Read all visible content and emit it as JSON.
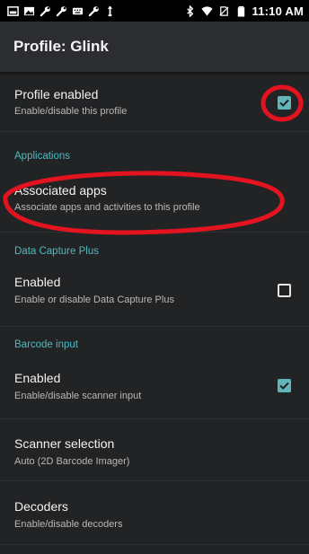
{
  "status_bar": {
    "time": "11:10 AM",
    "notification_icons": [
      "image-icon",
      "photo-icon",
      "wrench-icon",
      "wrench-icon",
      "keyboard-icon",
      "wrench-icon",
      "usb-icon"
    ],
    "system_icons": [
      "bluetooth-icon",
      "wifi-icon",
      "no-sim-icon",
      "battery-icon"
    ]
  },
  "app_bar": {
    "title": "Profile: Glink"
  },
  "preferences": {
    "profile_enabled": {
      "title": "Profile enabled",
      "summary": "Enable/disable this profile",
      "checked": true
    },
    "applications_header": "Applications",
    "associated_apps": {
      "title": "Associated apps",
      "summary": "Associate apps and activities to this profile"
    },
    "data_capture_header": "Data Capture Plus",
    "dcp_enabled": {
      "title": "Enabled",
      "summary": "Enable or disable Data Capture Plus",
      "checked": false
    },
    "barcode_header": "Barcode input",
    "barcode_enabled": {
      "title": "Enabled",
      "summary": "Enable/disable scanner input",
      "checked": true
    },
    "scanner_selection": {
      "title": "Scanner selection",
      "summary": "Auto (2D Barcode Imager)"
    },
    "decoders": {
      "title": "Decoders",
      "summary": "Enable/disable decoders"
    }
  },
  "colors": {
    "accent": "#4fb9c0",
    "checkbox_checked": "#62b6b9",
    "annotation_red": "#e3141f",
    "app_bar_bg": "#2b2d31",
    "background": "#222325"
  }
}
